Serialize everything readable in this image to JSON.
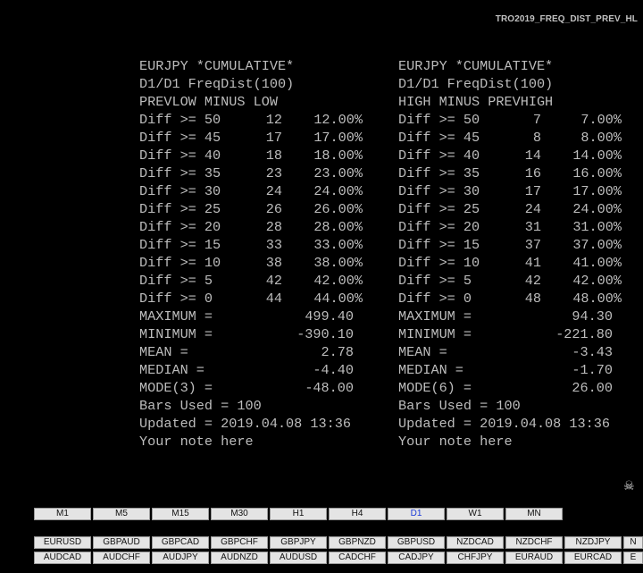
{
  "title": "TRO2019_FREQ_DIST_PREV_HL",
  "panels": [
    {
      "header": [
        "EURJPY *CUMULATIVE*",
        "D1/D1 FreqDist(100)",
        "PREVLOW MINUS LOW"
      ],
      "dist": [
        {
          "label": "Diff >= 50",
          "count": "12",
          "pct": "12.00%"
        },
        {
          "label": "Diff >= 45",
          "count": "17",
          "pct": "17.00%"
        },
        {
          "label": "Diff >= 40",
          "count": "18",
          "pct": "18.00%"
        },
        {
          "label": "Diff >= 35",
          "count": "23",
          "pct": "23.00%"
        },
        {
          "label": "Diff >= 30",
          "count": "24",
          "pct": "24.00%"
        },
        {
          "label": "Diff >= 25",
          "count": "26",
          "pct": "26.00%"
        },
        {
          "label": "Diff >= 20",
          "count": "28",
          "pct": "28.00%"
        },
        {
          "label": "Diff >= 15",
          "count": "33",
          "pct": "33.00%"
        },
        {
          "label": "Diff >= 10",
          "count": "38",
          "pct": "38.00%"
        },
        {
          "label": "Diff >= 5",
          "count": "42",
          "pct": "42.00%"
        },
        {
          "label": "Diff >= 0",
          "count": "44",
          "pct": "44.00%"
        }
      ],
      "stats": [
        {
          "label": "MAXIMUM =",
          "value": "499.40"
        },
        {
          "label": "MINIMUM =",
          "value": "-390.10"
        },
        {
          "label": "MEAN =",
          "value": "2.78"
        },
        {
          "label": "MEDIAN =",
          "value": "-4.40"
        },
        {
          "label": "MODE(3) =",
          "value": "-48.00"
        }
      ],
      "footer": [
        "Bars Used = 100",
        "Updated = 2019.04.08 13:36",
        "Your note here"
      ]
    },
    {
      "header": [
        "EURJPY *CUMULATIVE*",
        "D1/D1 FreqDist(100)",
        "HIGH MINUS PREVHIGH"
      ],
      "dist": [
        {
          "label": "Diff >= 50",
          "count": "7",
          "pct": "7.00%"
        },
        {
          "label": "Diff >= 45",
          "count": "8",
          "pct": "8.00%"
        },
        {
          "label": "Diff >= 40",
          "count": "14",
          "pct": "14.00%"
        },
        {
          "label": "Diff >= 35",
          "count": "16",
          "pct": "16.00%"
        },
        {
          "label": "Diff >= 30",
          "count": "17",
          "pct": "17.00%"
        },
        {
          "label": "Diff >= 25",
          "count": "24",
          "pct": "24.00%"
        },
        {
          "label": "Diff >= 20",
          "count": "31",
          "pct": "31.00%"
        },
        {
          "label": "Diff >= 15",
          "count": "37",
          "pct": "37.00%"
        },
        {
          "label": "Diff >= 10",
          "count": "41",
          "pct": "41.00%"
        },
        {
          "label": "Diff >= 5",
          "count": "42",
          "pct": "42.00%"
        },
        {
          "label": "Diff >= 0",
          "count": "48",
          "pct": "48.00%"
        }
      ],
      "stats": [
        {
          "label": "MAXIMUM =",
          "value": "94.30"
        },
        {
          "label": "MINIMUM =",
          "value": "-221.80"
        },
        {
          "label": "MEAN =",
          "value": "-3.43"
        },
        {
          "label": "MEDIAN =",
          "value": "-1.70"
        },
        {
          "label": "MODE(6) =",
          "value": "26.00"
        }
      ],
      "footer": [
        "Bars Used = 100",
        "Updated = 2019.04.08 13:36",
        "Your note here"
      ]
    }
  ],
  "skull_icon": "☠",
  "timeframes": {
    "items": [
      "M1",
      "M5",
      "M15",
      "M30",
      "H1",
      "H4",
      "D1",
      "W1",
      "MN"
    ],
    "active": "D1",
    "active_color": "#1a3ad8"
  },
  "symbols_row1": [
    "EURUSD",
    "GBPAUD",
    "GBPCAD",
    "GBPCHF",
    "GBPJPY",
    "GBPNZD",
    "GBPUSD",
    "NZDCAD",
    "NZDCHF",
    "NZDJPY",
    "N"
  ],
  "symbols_row2": [
    "AUDCAD",
    "AUDCHF",
    "AUDJPY",
    "AUDNZD",
    "AUDUSD",
    "CADCHF",
    "CADJPY",
    "CHFJPY",
    "EURAUD",
    "EURCAD",
    "E"
  ]
}
